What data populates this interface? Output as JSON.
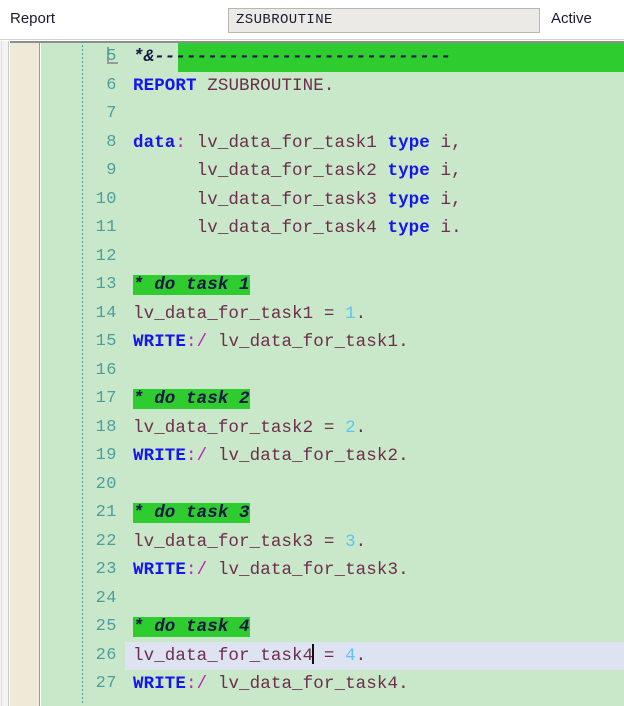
{
  "header": {
    "object_type_label": "Report",
    "object_name": "ZSUBROUTINE",
    "status": "Active"
  },
  "editor": {
    "first_visible_line": 5,
    "current_line": 26,
    "lines": [
      {
        "no": "5",
        "kind": "comment-banner",
        "text": "*&----------------------------"
      },
      {
        "no": "6",
        "kind": "code",
        "text": "REPORT ZSUBROUTINE."
      },
      {
        "no": "7",
        "kind": "blank",
        "text": ""
      },
      {
        "no": "8",
        "kind": "code",
        "text": "data: lv_data_for_task1 type i,"
      },
      {
        "no": "9",
        "kind": "code",
        "text": "      lv_data_for_task2 type i,"
      },
      {
        "no": "10",
        "kind": "code",
        "text": "      lv_data_for_task3 type i,"
      },
      {
        "no": "11",
        "kind": "code",
        "text": "      lv_data_for_task4 type i."
      },
      {
        "no": "12",
        "kind": "blank",
        "text": ""
      },
      {
        "no": "13",
        "kind": "comment",
        "text": "* do task 1"
      },
      {
        "no": "14",
        "kind": "code",
        "text": "lv_data_for_task1 = 1."
      },
      {
        "no": "15",
        "kind": "code",
        "text": "WRITE:/ lv_data_for_task1."
      },
      {
        "no": "16",
        "kind": "blank",
        "text": ""
      },
      {
        "no": "17",
        "kind": "comment",
        "text": "* do task 2"
      },
      {
        "no": "18",
        "kind": "code",
        "text": "lv_data_for_task2 = 2."
      },
      {
        "no": "19",
        "kind": "code",
        "text": "WRITE:/ lv_data_for_task2."
      },
      {
        "no": "20",
        "kind": "blank",
        "text": ""
      },
      {
        "no": "21",
        "kind": "comment",
        "text": "* do task 3"
      },
      {
        "no": "22",
        "kind": "code",
        "text": "lv_data_for_task3 = 3."
      },
      {
        "no": "23",
        "kind": "code",
        "text": "WRITE:/ lv_data_for_task3."
      },
      {
        "no": "24",
        "kind": "blank",
        "text": ""
      },
      {
        "no": "25",
        "kind": "comment",
        "text": "* do task 4"
      },
      {
        "no": "26",
        "kind": "code-current",
        "text": "lv_data_for_task4 = 4."
      },
      {
        "no": "27",
        "kind": "code",
        "text": "WRITE:/ lv_data_for_task4."
      }
    ]
  },
  "colors": {
    "code_background": "#c9e8c9",
    "bookmark_column": "#efe9d8",
    "comment_highlight": "#2ecc2e",
    "current_line_highlight": "#dde3f1",
    "keyword": "#1515ee",
    "identifier": "#6d2d4d",
    "number": "#5fc3f0",
    "punctuation": "#c01fc0",
    "line_number": "#4e9d9d"
  }
}
